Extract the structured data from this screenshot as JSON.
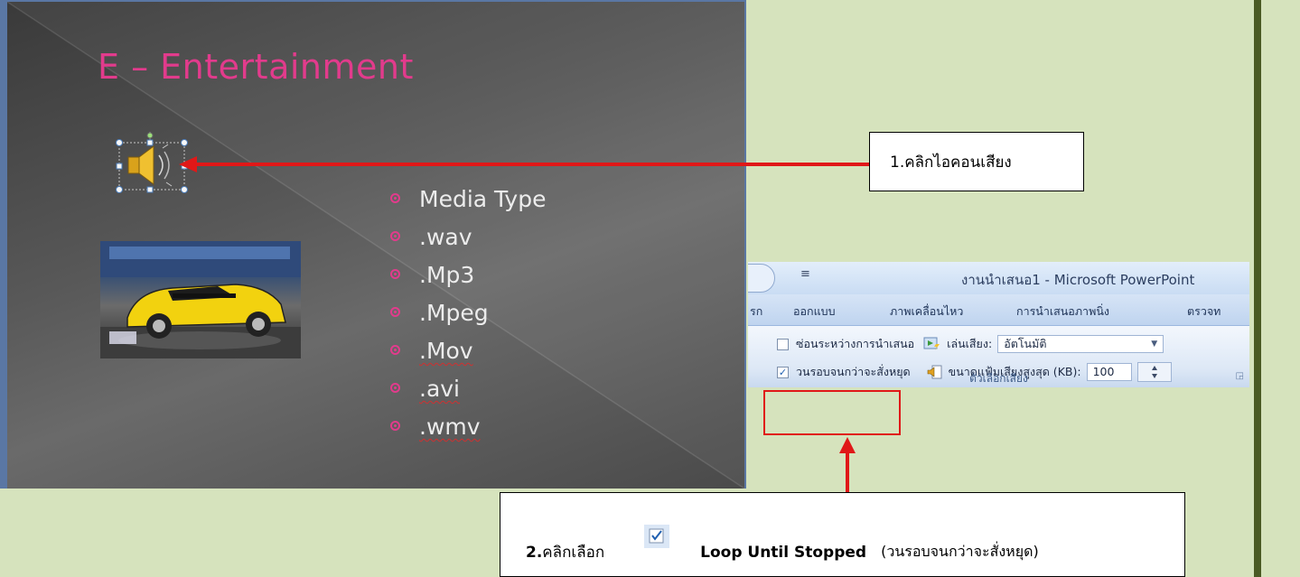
{
  "slide": {
    "title": "E – Entertainment",
    "bullets": [
      {
        "text": "Media Type",
        "misspelled": false
      },
      {
        "text": ".wav",
        "misspelled": false
      },
      {
        "text": ".Mp3",
        "misspelled": false
      },
      {
        "text": ".Mpeg",
        "misspelled": false
      },
      {
        "text": ".Mov",
        "misspelled": true
      },
      {
        "text": ".avi",
        "misspelled": true
      },
      {
        "text": ".wmv",
        "misspelled": true
      }
    ],
    "title_color": "#e23b8c",
    "bullet_color": "#e23b8c",
    "text_color": "#ececec"
  },
  "callout1": {
    "text": "1.คลิกไอคอนเสียง"
  },
  "callout2": {
    "step": "2.",
    "click_select": "คลิกเลือก",
    "option_en": "Loop Until Stopped",
    "option_th": "(วนรอบจนกว่าจะสั่งหยุด)"
  },
  "ribbon": {
    "window_title": "งานนำเสนอ1 - Microsoft PowerPoint",
    "tabs": [
      "รก",
      "ออกแบบ",
      "ภาพเคลื่อนไหว",
      "การนำเสนอภาพนิ่ง",
      "ตรวจท"
    ],
    "hide_during_show_label": "ซ่อนระหว่างการนำเสนอ",
    "hide_during_show_checked": false,
    "play_sound_label": "เล่นเสียง:",
    "play_sound_value": "อัตโนมัติ",
    "loop_label": "วนรอบจนกว่าจะสั่งหยุด",
    "loop_checked": true,
    "max_size_label": "ขนาดแฟ้มเสียงสูงสุด (KB):",
    "max_size_value": "100",
    "group_label": "ตัวเลือกเสียง"
  },
  "colors": {
    "arrow": "#e01818",
    "page_bg": "#d6e3bd",
    "side_bar": "#4a5a24"
  },
  "icons": {
    "speaker": "speaker-icon",
    "car_photo": "car-photo"
  }
}
